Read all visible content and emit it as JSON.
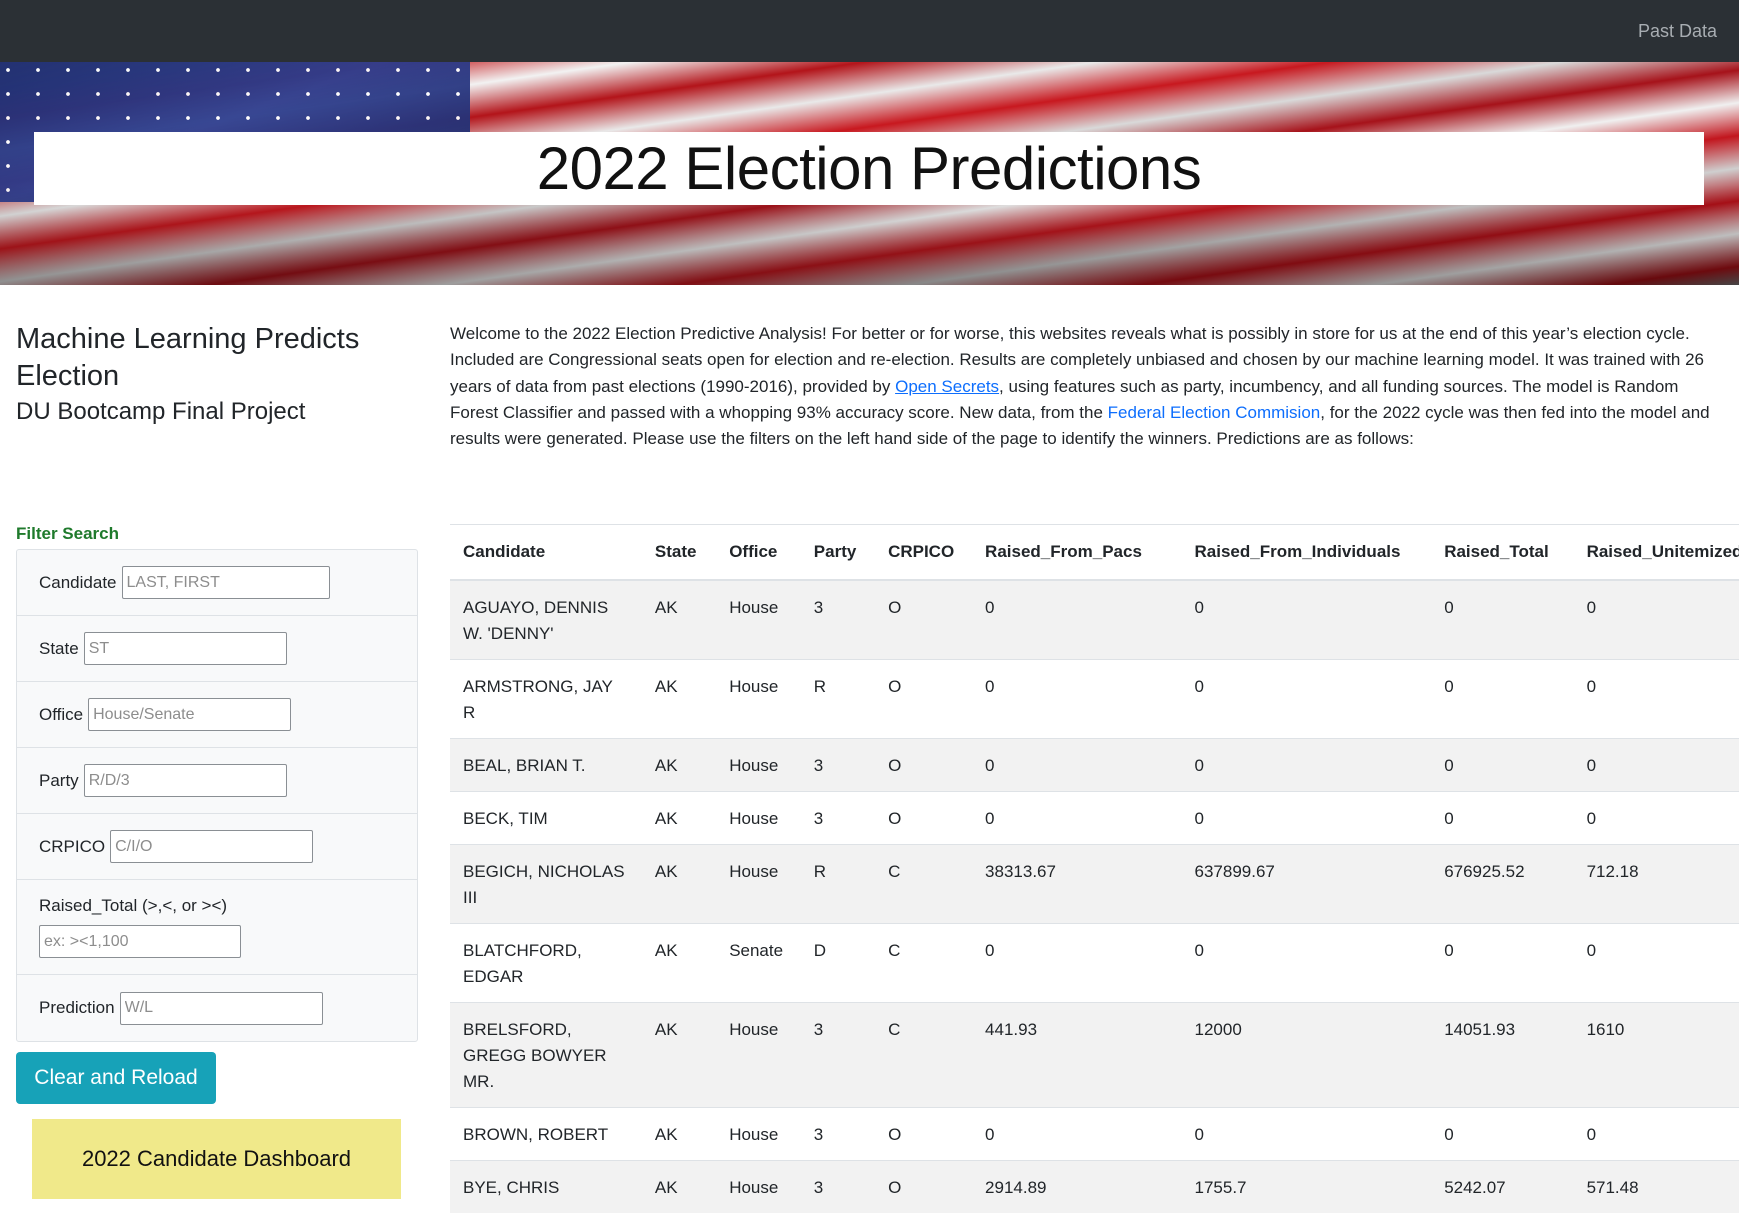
{
  "nav": {
    "past_data": "Past Data"
  },
  "banner": {
    "title": "2022 Election Predictions"
  },
  "heading": {
    "title": "Machine Learning Predicts Election",
    "subtitle": "DU Bootcamp Final Project"
  },
  "intro": {
    "part1": "Welcome to the 2022 Election Predictive Analysis! For better or for worse, this websites reveals what is possibly in store for us at the end of this year’s election cycle. Included are Congressional seats open for election and re-election. Results are completely unbiased and chosen by our machine learning model. It was trained with 26 years of data from past elections (1990-2016), provided by ",
    "link1": "Open Secrets",
    "part2": ", using features such as party, incumbency, and all funding sources. The model is Random Forest Classifier and passed with a whopping 93% accuracy score. New data, from the ",
    "link2": "Federal Election Commision",
    "part3": ", for the 2022 cycle was then fed into the model and results were generated. Please use the filters on the left hand side of the page to identify the winners. Predictions are as follows:"
  },
  "filters": {
    "title": "Filter Search",
    "candidate": {
      "label": "Candidate",
      "placeholder": "LAST, FIRST"
    },
    "state": {
      "label": "State",
      "placeholder": "ST"
    },
    "office": {
      "label": "Office",
      "placeholder": "House/Senate"
    },
    "party": {
      "label": "Party",
      "placeholder": "R/D/3"
    },
    "crpico": {
      "label": "CRPICO",
      "placeholder": "C/I/O"
    },
    "raised_total": {
      "label": "Raised_Total (>,<, or ><)",
      "placeholder": "ex: ><1,100"
    },
    "prediction": {
      "label": "Prediction",
      "placeholder": "W/L"
    }
  },
  "buttons": {
    "clear": "Clear and Reload",
    "dashboard": "2022 Candidate Dashboard"
  },
  "table": {
    "headers": [
      "Candidate",
      "State",
      "Office",
      "Party",
      "CRPICO",
      "Raised_From_Pacs",
      "Raised_From_Individuals",
      "Raised_Total",
      "Raised_Unitemized"
    ],
    "rows": [
      [
        "AGUAYO, DENNIS W. 'DENNY'",
        "AK",
        "House",
        "3",
        "O",
        "0",
        "0",
        "0",
        "0"
      ],
      [
        "ARMSTRONG, JAY R",
        "AK",
        "House",
        "R",
        "O",
        "0",
        "0",
        "0",
        "0"
      ],
      [
        "BEAL, BRIAN T.",
        "AK",
        "House",
        "3",
        "O",
        "0",
        "0",
        "0",
        "0"
      ],
      [
        "BECK, TIM",
        "AK",
        "House",
        "3",
        "O",
        "0",
        "0",
        "0",
        "0"
      ],
      [
        "BEGICH, NICHOLAS III",
        "AK",
        "House",
        "R",
        "C",
        "38313.67",
        "637899.67",
        "676925.52",
        "712.18"
      ],
      [
        "BLATCHFORD, EDGAR",
        "AK",
        "Senate",
        "D",
        "C",
        "0",
        "0",
        "0",
        "0"
      ],
      [
        "BRELSFORD, GREGG BOWYER MR.",
        "AK",
        "House",
        "3",
        "C",
        "441.93",
        "12000",
        "14051.93",
        "1610"
      ],
      [
        "BROWN, ROBERT",
        "AK",
        "House",
        "3",
        "O",
        "0",
        "0",
        "0",
        "0"
      ],
      [
        "BYE, CHRIS",
        "AK",
        "House",
        "3",
        "O",
        "2914.89",
        "1755.7",
        "5242.07",
        "571.48"
      ]
    ]
  }
}
